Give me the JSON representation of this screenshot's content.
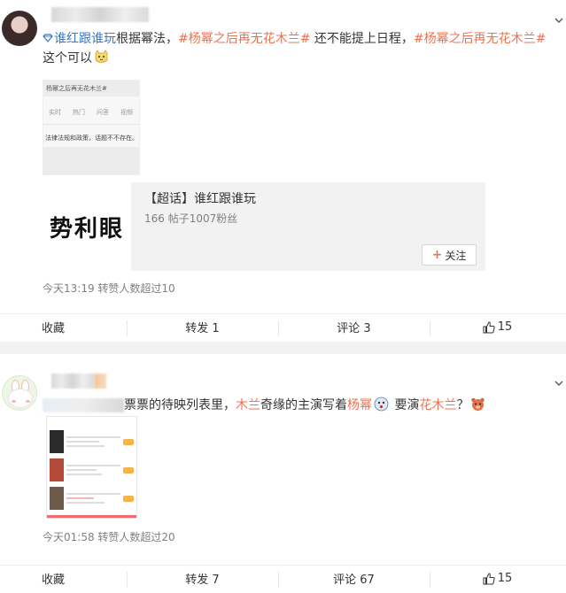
{
  "post1": {
    "content": {
      "supertopic": "谁红跟谁玩",
      "text1": "根据幂法，",
      "hashtag1": "#杨幂之后再无花木兰#",
      "text2": " 还不能提上日程，",
      "hashtag2": "#杨幂之后再无花木兰#",
      "text3": " 这个可以"
    },
    "thumbnail": {
      "header": "杨幂之后再无花木兰#",
      "tabs": [
        "实时",
        "热门",
        "问答",
        "视频"
      ],
      "message": "法律法规和政策，话题不不存在。"
    },
    "card": {
      "image_text": "势利眼",
      "title": "【超话】谁红跟谁玩",
      "subtitle": "166 帖子1007粉丝",
      "follow_label": "关注"
    },
    "meta": "今天13:19 转赞人数超过10",
    "actions": {
      "favorite": "收藏",
      "repost": "转发 1",
      "comment": "评论 3",
      "like": "15"
    }
  },
  "post2": {
    "content": {
      "text1": "票票的待映列表里，",
      "mention1": "木兰",
      "text2": "奇缘的主演写着",
      "mention2": "杨幂",
      "text3": " 要演",
      "mention3": "花木兰",
      "text4": "？"
    },
    "meta": "今天01:58 转赞人数超过20",
    "actions": {
      "favorite": "收藏",
      "repost": "转发 7",
      "comment": "评论 67",
      "like": "15"
    }
  },
  "colors": {
    "link": "#eb7350",
    "supertopic": "#3b78c3",
    "meta": "#808080"
  }
}
